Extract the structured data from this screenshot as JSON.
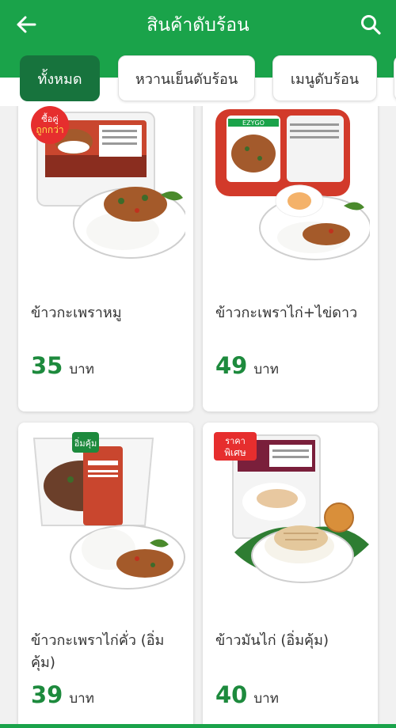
{
  "header": {
    "title": "สินค้าดับร้อน",
    "back_icon": "arrow-left-icon",
    "search_icon": "search-icon"
  },
  "tabs": [
    {
      "label": "ทั้งหมด",
      "active": true
    },
    {
      "label": "หวานเย็นดับร้อน",
      "active": false
    },
    {
      "label": "เมนูดับร้อน",
      "active": false
    }
  ],
  "products": [
    {
      "name": "ข้าวกะเพราหมู",
      "price": "35",
      "unit": "บาท",
      "badge": "ซื้อคู่ ถูกกว่า"
    },
    {
      "name": "ข้าวกะเพราไก่+ไข่ดาว",
      "price": "49",
      "unit": "บาท",
      "badge": "EZYGO"
    },
    {
      "name": "ข้าวกะเพราไก่คั่ว (อิ่มคุ้ม)",
      "price": "39",
      "unit": "บาท",
      "badge": "อิ่มคุ้ม"
    },
    {
      "name": "ข้าวมันไก่ (อิ่มคุ้ม)",
      "price": "40",
      "unit": "บาท",
      "badge": "ราคาพิเศษ"
    }
  ],
  "colors": {
    "brand": "#1aa34a",
    "active_tab": "#17733d",
    "price": "#1d8a3d"
  }
}
